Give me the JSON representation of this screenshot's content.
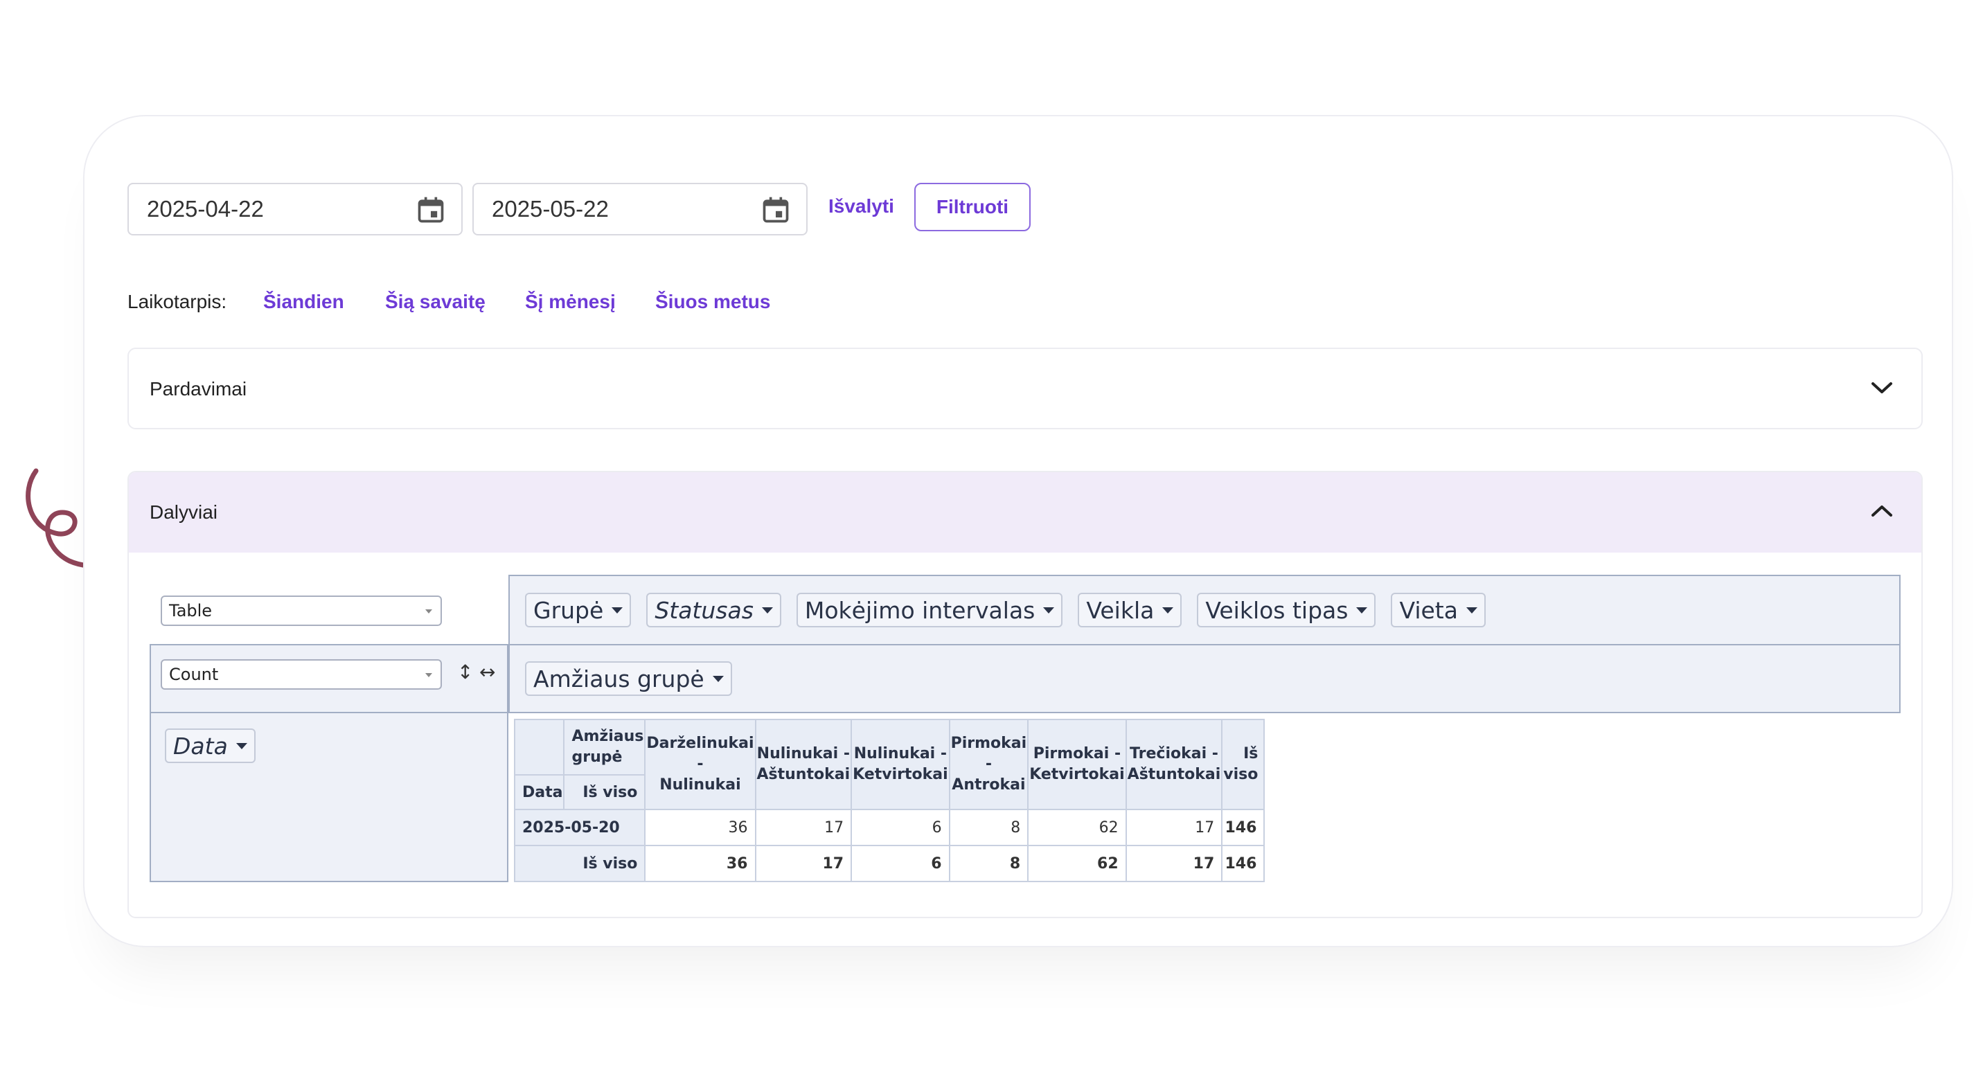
{
  "filters": {
    "date_from": "2025-04-22",
    "date_to": "2025-05-22",
    "clear_label": "Išvalyti",
    "filter_label": "Filtruoti"
  },
  "period": {
    "label": "Laikotarpis:",
    "options": [
      "Šiandien",
      "Šią savaitę",
      "Šį mėnesį",
      "Šiuos metus"
    ]
  },
  "panels": {
    "sales_title": "Pardavimai",
    "participants_title": "Dalyviai"
  },
  "pivot": {
    "renderer": "Table",
    "aggregator": "Count",
    "sort_row_glyph": "↕",
    "sort_col_glyph": "↔",
    "unused_attrs": [
      "Grupė",
      "Statusas",
      "Mokėjimo intervalas",
      "Veikla",
      "Veiklos tipas",
      "Vieta"
    ],
    "col_attr": "Amžiaus grupė",
    "row_attr": "Data",
    "table": {
      "col_attr_label": "Amžiaus grupė",
      "row_attr_label": "Data",
      "total_label": "Iš viso",
      "columns": [
        [
          "Darželinukai -",
          "Nulinukai"
        ],
        [
          "Nulinukai -",
          "Aštuntokai"
        ],
        [
          "Nulinukai -",
          "Ketvirtokai"
        ],
        [
          "Pirmokai -",
          "Antrokai"
        ],
        [
          "Pirmokai -",
          "Ketvirtokai"
        ],
        [
          "Trečiokai -",
          "Aštuntokai"
        ]
      ],
      "total_header": [
        "Iš",
        "viso"
      ],
      "rows": [
        {
          "label": "2025-05-20",
          "values": [
            "36",
            "17",
            "6",
            "8",
            "62",
            "17"
          ],
          "total": "146"
        }
      ],
      "col_totals": [
        "36",
        "17",
        "6",
        "8",
        "62",
        "17"
      ],
      "grand_total": "146"
    }
  }
}
